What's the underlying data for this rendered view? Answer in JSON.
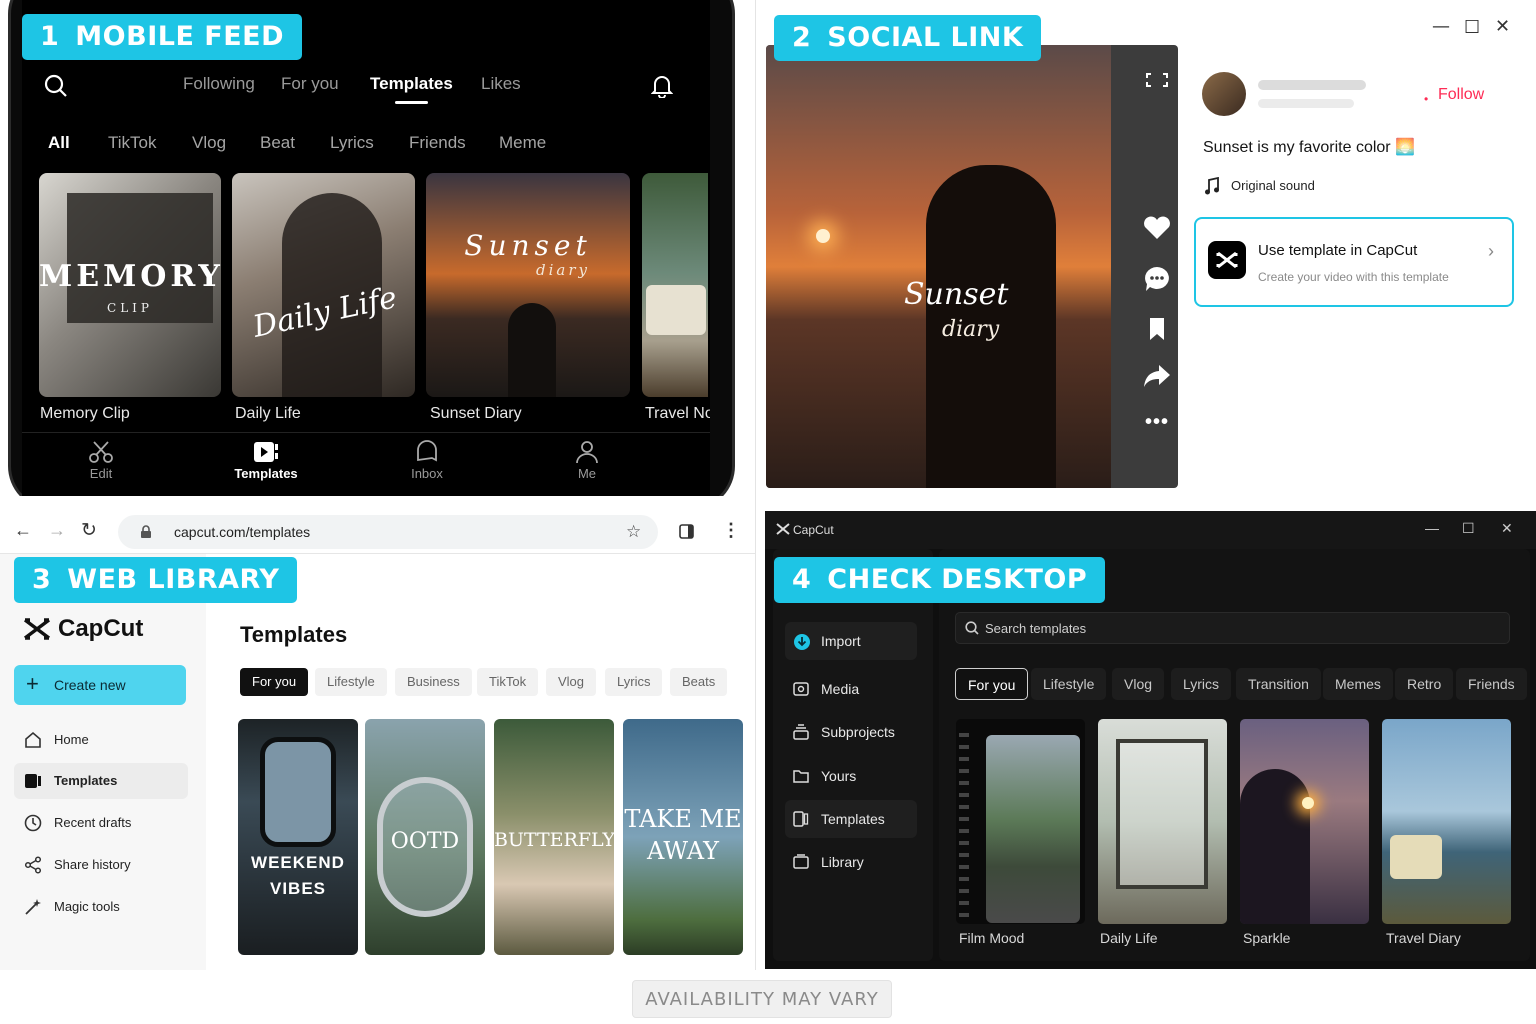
{
  "panels": {
    "p1": {
      "num": "1",
      "title": "MOBILE FEED"
    },
    "p2": {
      "num": "2",
      "title": "SOCIAL LINK"
    },
    "p3": {
      "num": "3",
      "title": "WEB LIBRARY"
    },
    "p4": {
      "num": "4",
      "title": "CHECK DESKTOP"
    }
  },
  "mobile": {
    "top_tabs": [
      "Following",
      "For you",
      "Templates",
      "Likes"
    ],
    "active_top_tab": "Templates",
    "chips": [
      "All",
      "TikTok",
      "Vlog",
      "Beat",
      "Lyrics",
      "Friends",
      "Meme"
    ],
    "active_chip": "All",
    "cards": [
      {
        "caption": "Memory Clip",
        "overlay": "MEMORY",
        "overlay_sub": "CLIP"
      },
      {
        "caption": "Daily Life",
        "overlay": "Daily Life"
      },
      {
        "caption": "Sunset Diary",
        "overlay": "Sunset",
        "overlay_sub": "diary"
      },
      {
        "caption": "Travel No"
      }
    ],
    "bottom_nav": [
      "Edit",
      "Templates",
      "Inbox",
      "Me"
    ],
    "active_bottom": "Templates"
  },
  "social": {
    "video_title": "Sunset",
    "video_sub": "diary",
    "follow": "Follow",
    "caption": "Sunset is my favorite color 🌅",
    "sound": "Original sound",
    "cta_title": "Use template in CapCut",
    "cta_sub": "Create your video with this template"
  },
  "web": {
    "url": "capcut.com/templates",
    "brand": "CapCut",
    "create_new": "Create new",
    "nav": [
      "Home",
      "Templates",
      "Recent drafts",
      "Share history",
      "Magic tools"
    ],
    "active_nav": "Templates",
    "heading": "Templates",
    "chips": [
      "For you",
      "Lifestyle",
      "Business",
      "TikTok",
      "Vlog",
      "Lyrics",
      "Beats"
    ],
    "cards": [
      {
        "title": "WEEKEND",
        "sub": "VIBES"
      },
      {
        "title": "OOTD"
      },
      {
        "title": "BUTTERFLY"
      },
      {
        "title": "TAKE ME",
        "sub": "AWAY"
      }
    ]
  },
  "desktop": {
    "app_name": "CapCut",
    "search_placeholder": "Search templates",
    "nav": [
      "Import",
      "Media",
      "Subprojects",
      "Yours",
      "Templates",
      "Library"
    ],
    "chips": [
      "For you",
      "Lifestyle",
      "Vlog",
      "Lyrics",
      "Transition",
      "Memes",
      "Retro",
      "Friends"
    ],
    "cards": [
      "Film Mood",
      "Daily Life",
      "Sparkle",
      "Travel Diary"
    ]
  },
  "footer": "AVAILABILITY MAY VARY",
  "colors": {
    "accent": "#1ec5e5",
    "follow": "#fe2c55",
    "dark": "#0f0f0f"
  }
}
